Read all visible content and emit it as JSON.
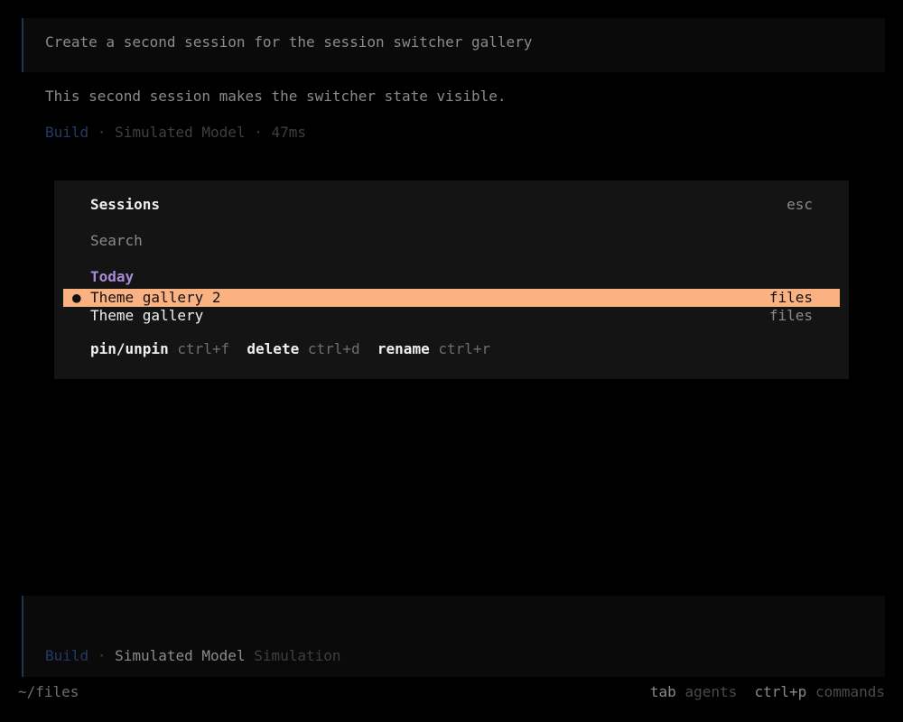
{
  "transcript": {
    "user_message": "Create a second session for the session switcher gallery",
    "assistant_message": "This second session makes the switcher state visible.",
    "meta": {
      "agent": "Build",
      "separator": " · ",
      "model": "Simulated Model",
      "duration": "47ms"
    }
  },
  "dialog": {
    "title": "Sessions",
    "close_hint": "esc",
    "search_placeholder": "Search",
    "groups": [
      {
        "label": "Today",
        "sessions": [
          {
            "marker": "●",
            "title": "Theme gallery 2",
            "directory": "files",
            "selected": true
          },
          {
            "marker": "",
            "title": "Theme gallery",
            "directory": "files",
            "selected": false
          }
        ]
      }
    ],
    "actions": [
      {
        "label": "pin/unpin",
        "key": "ctrl+f"
      },
      {
        "label": "delete",
        "key": "ctrl+d"
      },
      {
        "label": "rename",
        "key": "ctrl+r"
      }
    ]
  },
  "prompt": {
    "agent": "Build",
    "separator": " · ",
    "model": "Simulated Model",
    "provider": "Simulation"
  },
  "footer": {
    "path": "~/files",
    "shortcuts": [
      {
        "key": "tab",
        "label": "agents"
      },
      {
        "key": "ctrl+p",
        "label": "commands"
      }
    ]
  },
  "colors": {
    "background": "#000000",
    "panel": "#141414",
    "selection": "#fbb283",
    "group_header": "#a98ad6",
    "agent_accent": "#243a66"
  }
}
